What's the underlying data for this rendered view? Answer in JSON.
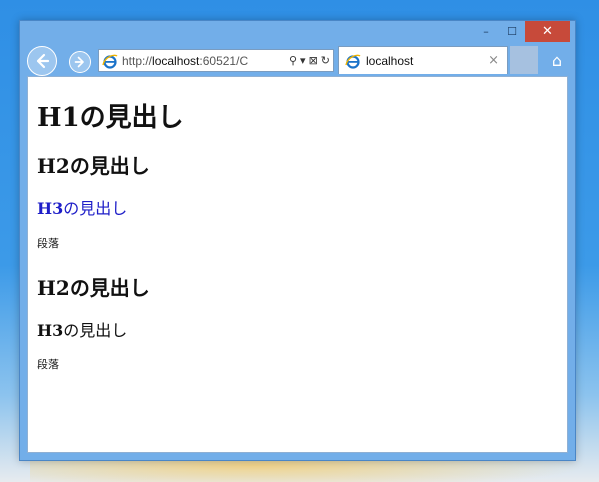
{
  "window": {
    "controls": {
      "minimize": "–",
      "maximize": "☐",
      "close": "✕"
    }
  },
  "toolbar": {
    "back_icon": "arrow-left-icon",
    "forward_icon": "arrow-right-icon",
    "address_url_prefix": "http://",
    "address_url_host": "localhost",
    "address_url_rest": ":60521/C",
    "search_glyph": "⚲",
    "dropdown_glyph": "▾",
    "compat_glyph": "⊠",
    "refresh_glyph": "↻",
    "home_glyph": "⌂"
  },
  "tab": {
    "title": "localhost",
    "close_glyph": "×"
  },
  "page": {
    "h1": "H1の見出し",
    "h2_first": "H2の見出し",
    "h3_first_prefix": "H3",
    "h3_first_suffix": "の見出し",
    "p_first": "段落",
    "h2_second": "H2の見出し",
    "h3_second_prefix": "H3",
    "h3_second_suffix": "の見出し",
    "p_second": "段落"
  },
  "colors": {
    "link_heading": "#1e1ec8",
    "window_frame": "#72aee9",
    "close_button": "#c74a3a"
  }
}
